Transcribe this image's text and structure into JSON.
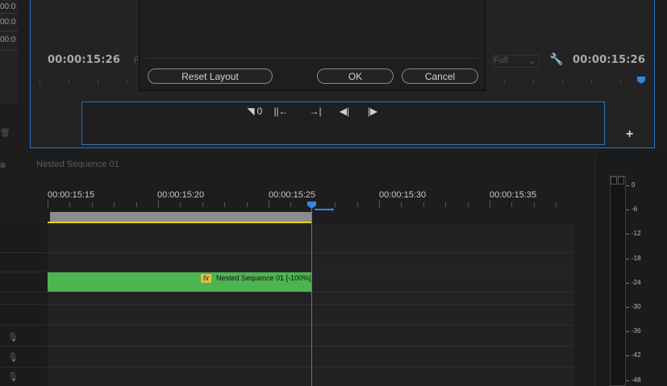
{
  "left_panel": {
    "values": [
      "00:0",
      "00:0",
      "00:0"
    ]
  },
  "monitor": {
    "timecode_left": "00:00:15:26",
    "timecode_right": "00:00:15:26",
    "zoom_partial": "F",
    "resolution": "Full",
    "add_label": "+"
  },
  "dialog": {
    "reset_label": "Reset Layout",
    "ok_label": "OK",
    "cancel_label": "Cancel"
  },
  "timeline": {
    "sequence_name": "Nested Sequence 01",
    "ruler_times": [
      "00:00:15:15",
      "00:00:15:20",
      "00:00:15:25",
      "00:00:15:30",
      "00:00:15:35"
    ],
    "clip": {
      "fx": "fx",
      "label": "Nested Sequence 01 [-100%]"
    }
  },
  "meter": {
    "db_labels": [
      "0",
      "-6",
      "-12",
      "-18",
      "-24",
      "-30",
      "-36",
      "-42",
      "-48"
    ]
  }
}
